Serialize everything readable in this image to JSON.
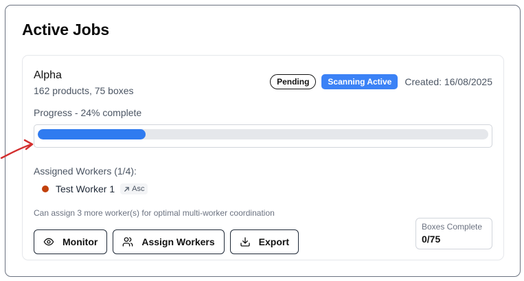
{
  "section": {
    "title": "Active Jobs"
  },
  "job": {
    "name": "Alpha",
    "summary": "162 products, 75 boxes",
    "status_badge": "Pending",
    "scan_badge": "Scanning Active",
    "created": "Created: 16/08/2025",
    "progress_label": "Progress - 24% complete",
    "progress_percent": 24,
    "workers_label": "Assigned Workers (1/4):",
    "workers": [
      {
        "name": "Test Worker 1",
        "tag": "Asc",
        "status_color": "#c2410c"
      }
    ],
    "hint": "Can assign 3 more worker(s) for optimal multi-worker coordination",
    "buttons": {
      "monitor": "Monitor",
      "assign": "Assign Workers",
      "export": "Export"
    },
    "boxes": {
      "label": "Boxes Complete",
      "value": "0/75"
    }
  },
  "colors": {
    "accent": "#3b82f6",
    "progress_fill": "#2f7bf0",
    "annotation": "#d32f2f"
  },
  "icons": {
    "monitor": "eye-icon",
    "assign": "users-icon",
    "export": "download-icon",
    "worker_tag": "arrow-up-right-icon"
  }
}
